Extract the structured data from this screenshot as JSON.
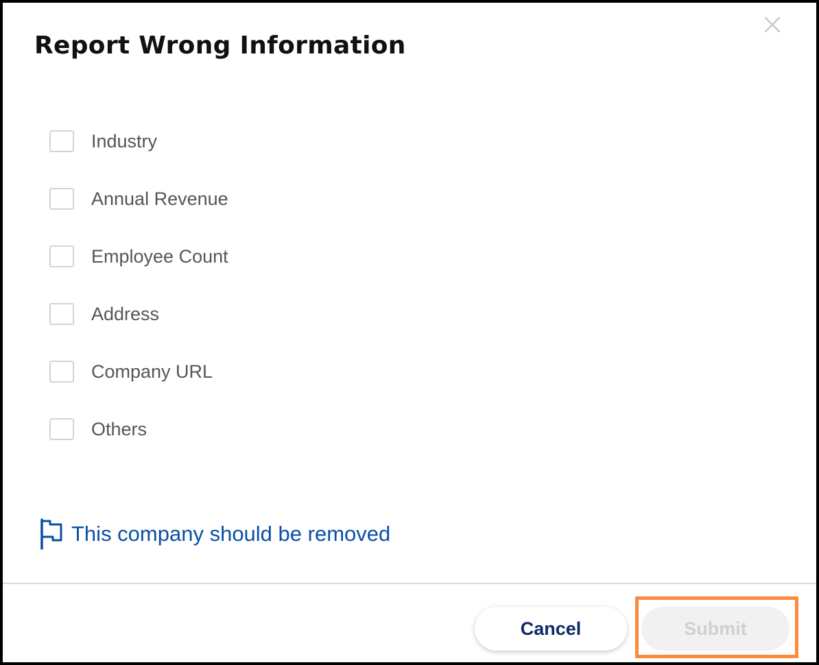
{
  "dialog": {
    "title": "Report Wrong Information",
    "close_icon": "close-icon"
  },
  "options": [
    {
      "label": "Industry",
      "checked": false
    },
    {
      "label": "Annual Revenue",
      "checked": false
    },
    {
      "label": "Employee Count",
      "checked": false
    },
    {
      "label": "Address",
      "checked": false
    },
    {
      "label": "Company URL",
      "checked": false
    },
    {
      "label": "Others",
      "checked": false
    }
  ],
  "remove_link": {
    "icon": "flag-icon",
    "label": "This company should be removed"
  },
  "footer": {
    "cancel_label": "Cancel",
    "submit_label": "Submit",
    "submit_disabled": true
  },
  "colors": {
    "link": "#0a4fa6",
    "cancel_text": "#0c2a66",
    "submit_disabled_bg": "#f1f1f1",
    "submit_disabled_text": "#d0d0d0",
    "highlight": "#fb8a3c"
  }
}
